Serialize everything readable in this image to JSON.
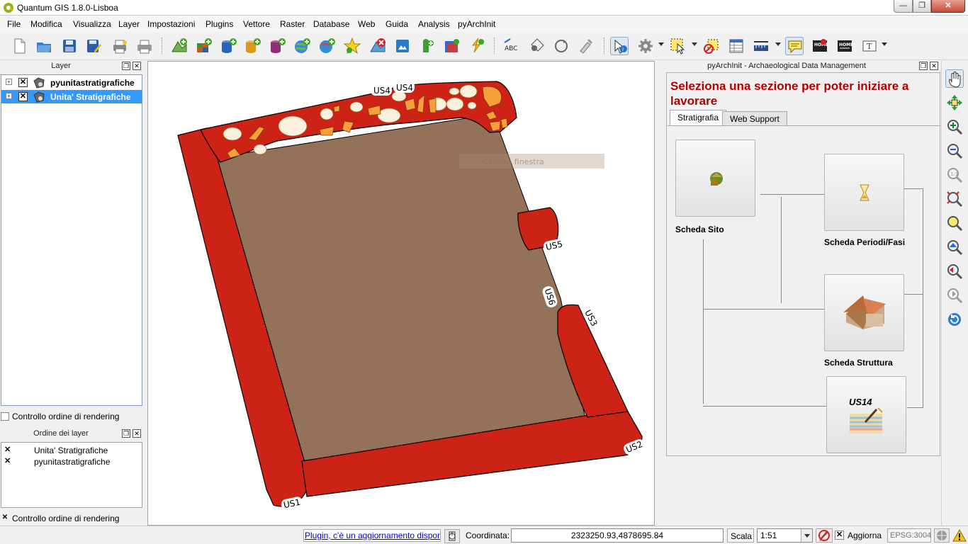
{
  "window": {
    "title": "Quantum GIS 1.8.0-Lisboa",
    "controls": {
      "minimize": "—",
      "maximize": "❐",
      "close": "✕"
    }
  },
  "menubar": {
    "items": [
      "File",
      "Modifica",
      "Visualizza",
      "Layer",
      "Impostazioni",
      "Plugins",
      "Vettore",
      "Raster",
      "Database",
      "Web",
      "Guida",
      "Analysis",
      "pyArchInit"
    ]
  },
  "layers_panel": {
    "title": "Layer",
    "layers": [
      {
        "name": "pyunitastratigrafiche",
        "checked": true,
        "selected": false
      },
      {
        "name": "Unita' Stratigrafiche",
        "checked": true,
        "selected": true
      }
    ],
    "render_order_label": "Controllo ordine di rendering",
    "render_order_checked": false
  },
  "order_panel": {
    "title": "Ordine dei layer",
    "layers": [
      "Unita' Stratigrafiche",
      "pyunitastratigrafiche"
    ],
    "render_order_label": "Controllo ordine di rendering",
    "render_order_checked": true
  },
  "map": {
    "labels": {
      "us4a": "US4",
      "us4b": "US4",
      "us5": "US5",
      "us6": "US6",
      "us3": "US3",
      "us2": "US2",
      "us1": "US1"
    },
    "capture_hint": "Cattura finestra",
    "colors": {
      "wall": "#cc2316",
      "fill": "#937259",
      "stone_light": "#fbf0dc",
      "stone_orange": "#f5a03a"
    }
  },
  "pyarchinit_panel": {
    "title": "pyArchInit - Archaeological Data Management",
    "heading": "Seleziona una sezione per poter iniziare a lavorare",
    "tabs": [
      {
        "label": "Stratigrafia",
        "active": true
      },
      {
        "label": "Web Support",
        "active": false
      }
    ],
    "cards": {
      "sito": "Scheda Sito",
      "periodi": "Scheda Periodi/Fasi",
      "struttura": "Scheda Struttura",
      "us": "US14"
    }
  },
  "statusbar": {
    "plugin_update": "Plugin, c'è un aggiornamento disponibile",
    "coord_label": "Coordinata:",
    "coord_value": "2323250.93,4878695.84",
    "scale_label": "Scala",
    "scale_value": "1:51",
    "refresh_label": "Aggiorna",
    "refresh_checked": true,
    "crs": "EPSG:3004"
  }
}
